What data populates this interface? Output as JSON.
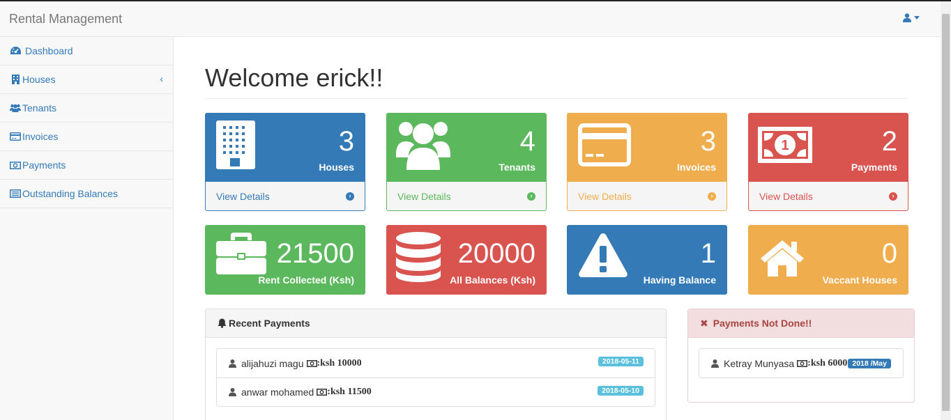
{
  "app": {
    "title": "Rental Management"
  },
  "sidebar": {
    "items": [
      {
        "label": "Dashboard",
        "icon": "dashboard-icon"
      },
      {
        "label": "Houses",
        "icon": "building-icon"
      },
      {
        "label": "Tenants",
        "icon": "users-icon"
      },
      {
        "label": "Invoices",
        "icon": "credit-card-icon"
      },
      {
        "label": "Payments",
        "icon": "money-icon"
      },
      {
        "label": "Outstanding Balances",
        "icon": "list-icon"
      }
    ]
  },
  "main": {
    "heading": "Welcome erick!!",
    "stat_cards": [
      {
        "value": "3",
        "label": "Houses",
        "link": "View Details",
        "color": "#337ab7"
      },
      {
        "value": "4",
        "label": "Tenants",
        "link": "View Details",
        "color": "#5cb85c"
      },
      {
        "value": "3",
        "label": "Invoices",
        "link": "View Details",
        "color": "#f0ad4e"
      },
      {
        "value": "2",
        "label": "Payments",
        "link": "View Details",
        "color": "#d9534f"
      }
    ],
    "summary_cards": [
      {
        "value": "21500",
        "label": "Rent Collected (Ksh)",
        "color": "#5cb85c"
      },
      {
        "value": "20000",
        "label": "All Balances (Ksh)",
        "color": "#d9534f"
      },
      {
        "value": "1",
        "label": "Having Balance",
        "color": "#337ab7"
      },
      {
        "value": "0",
        "label": "Vaccant Houses",
        "color": "#f0ad4e"
      }
    ],
    "recent_payments": {
      "title": "Recent Payments",
      "rows": [
        {
          "name": "alijahuzi magu",
          "amount": ":ksh 10000",
          "date": "2018-05-11"
        },
        {
          "name": "anwar mohamed",
          "amount": ":ksh 11500",
          "date": "2018-05-10"
        }
      ]
    },
    "payments_not_done": {
      "title": "Payments Not Done!!",
      "rows": [
        {
          "name": "Ketray Munyasa",
          "amount": ":ksh 6000",
          "period": "2018 /May"
        }
      ]
    }
  }
}
